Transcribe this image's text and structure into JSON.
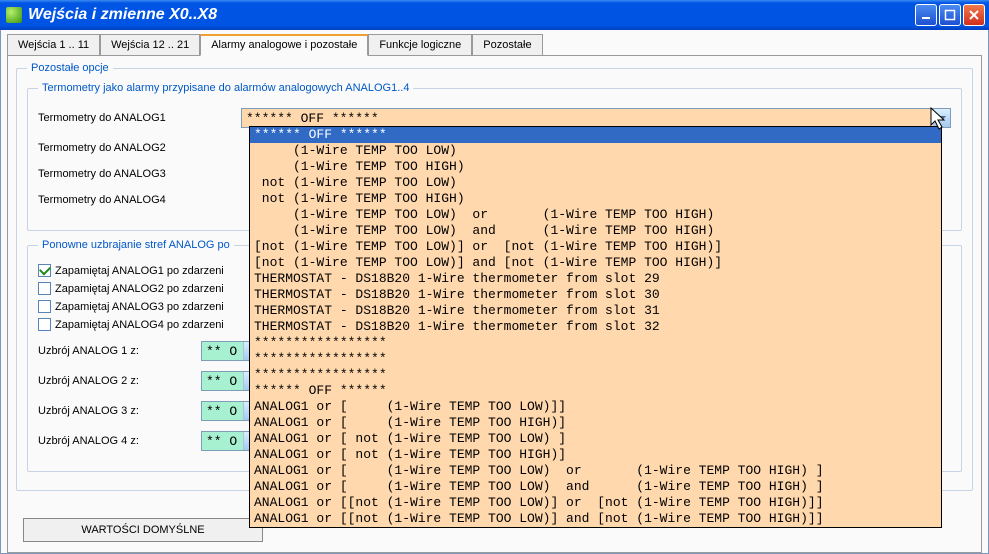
{
  "window": {
    "title": "Wejścia i zmienne X0..X8"
  },
  "tabs": [
    {
      "label": "Wejścia 1 .. 11",
      "active": false
    },
    {
      "label": "Wejścia 12 .. 21",
      "active": false
    },
    {
      "label": "Alarmy analogowe i pozostałe",
      "active": true
    },
    {
      "label": "Funkcje logiczne",
      "active": false
    },
    {
      "label": "Pozostałe",
      "active": false
    }
  ],
  "groups": {
    "other_options": "Pozostałe opcje",
    "thermo_alarms": "Termometry jako alarmy przypisane do alarmów analogowych ANALOG1..4",
    "rearm": "Ponowne uzbrajanie stref ANALOG po"
  },
  "thermo_rows": [
    {
      "label": "Termometry do ANALOG1",
      "value": "****** OFF ******"
    },
    {
      "label": "Termometry do ANALOG2"
    },
    {
      "label": "Termometry do ANALOG3"
    },
    {
      "label": "Termometry do ANALOG4"
    }
  ],
  "remember": [
    {
      "label": "Zapamiętaj ANALOG1 po zdarzeni",
      "checked": true
    },
    {
      "label": "Zapamiętaj ANALOG2 po zdarzeni",
      "checked": false
    },
    {
      "label": "Zapamiętaj ANALOG3 po zdarzeni",
      "checked": false
    },
    {
      "label": "Zapamiętaj ANALOG4 po zdarzeni",
      "checked": false
    }
  ],
  "arm": [
    {
      "label": "Uzbrój ANALOG 1 z:",
      "value": "** O"
    },
    {
      "label": "Uzbrój ANALOG 2 z:",
      "value": "** O"
    },
    {
      "label": "Uzbrój ANALOG 3 z:",
      "value": "** O"
    },
    {
      "label": "Uzbrój ANALOG 4 z:",
      "value": "** O"
    }
  ],
  "defaults_btn": "WARTOŚCI DOMYŚLNE",
  "dropdown": {
    "selected_index": 0,
    "items": [
      "****** OFF ******",
      "     (1-Wire TEMP TOO LOW)",
      "     (1-Wire TEMP TOO HIGH)",
      " not (1-Wire TEMP TOO LOW)",
      " not (1-Wire TEMP TOO HIGH)",
      "     (1-Wire TEMP TOO LOW)  or       (1-Wire TEMP TOO HIGH)",
      "     (1-Wire TEMP TOO LOW)  and      (1-Wire TEMP TOO HIGH)",
      "[not (1-Wire TEMP TOO LOW)] or  [not (1-Wire TEMP TOO HIGH)]",
      "[not (1-Wire TEMP TOO LOW)] and [not (1-Wire TEMP TOO HIGH)]",
      "THERMOSTAT - DS18B20 1-Wire thermometer from slot 29",
      "THERMOSTAT - DS18B20 1-Wire thermometer from slot 30",
      "THERMOSTAT - DS18B20 1-Wire thermometer from slot 31",
      "THERMOSTAT - DS18B20 1-Wire thermometer from slot 32",
      "*****************",
      "*****************",
      "*****************",
      "****** OFF ******",
      "ANALOG1 or [     (1-Wire TEMP TOO LOW)]]",
      "ANALOG1 or [     (1-Wire TEMP TOO HIGH)]",
      "ANALOG1 or [ not (1-Wire TEMP TOO LOW) ]",
      "ANALOG1 or [ not (1-Wire TEMP TOO HIGH)]",
      "ANALOG1 or [     (1-Wire TEMP TOO LOW)  or       (1-Wire TEMP TOO HIGH) ]",
      "ANALOG1 or [     (1-Wire TEMP TOO LOW)  and      (1-Wire TEMP TOO HIGH) ]",
      "ANALOG1 or [[not (1-Wire TEMP TOO LOW)] or  [not (1-Wire TEMP TOO HIGH)]]",
      "ANALOG1 or [[not (1-Wire TEMP TOO LOW)] and [not (1-Wire TEMP TOO HIGH)]]"
    ]
  }
}
